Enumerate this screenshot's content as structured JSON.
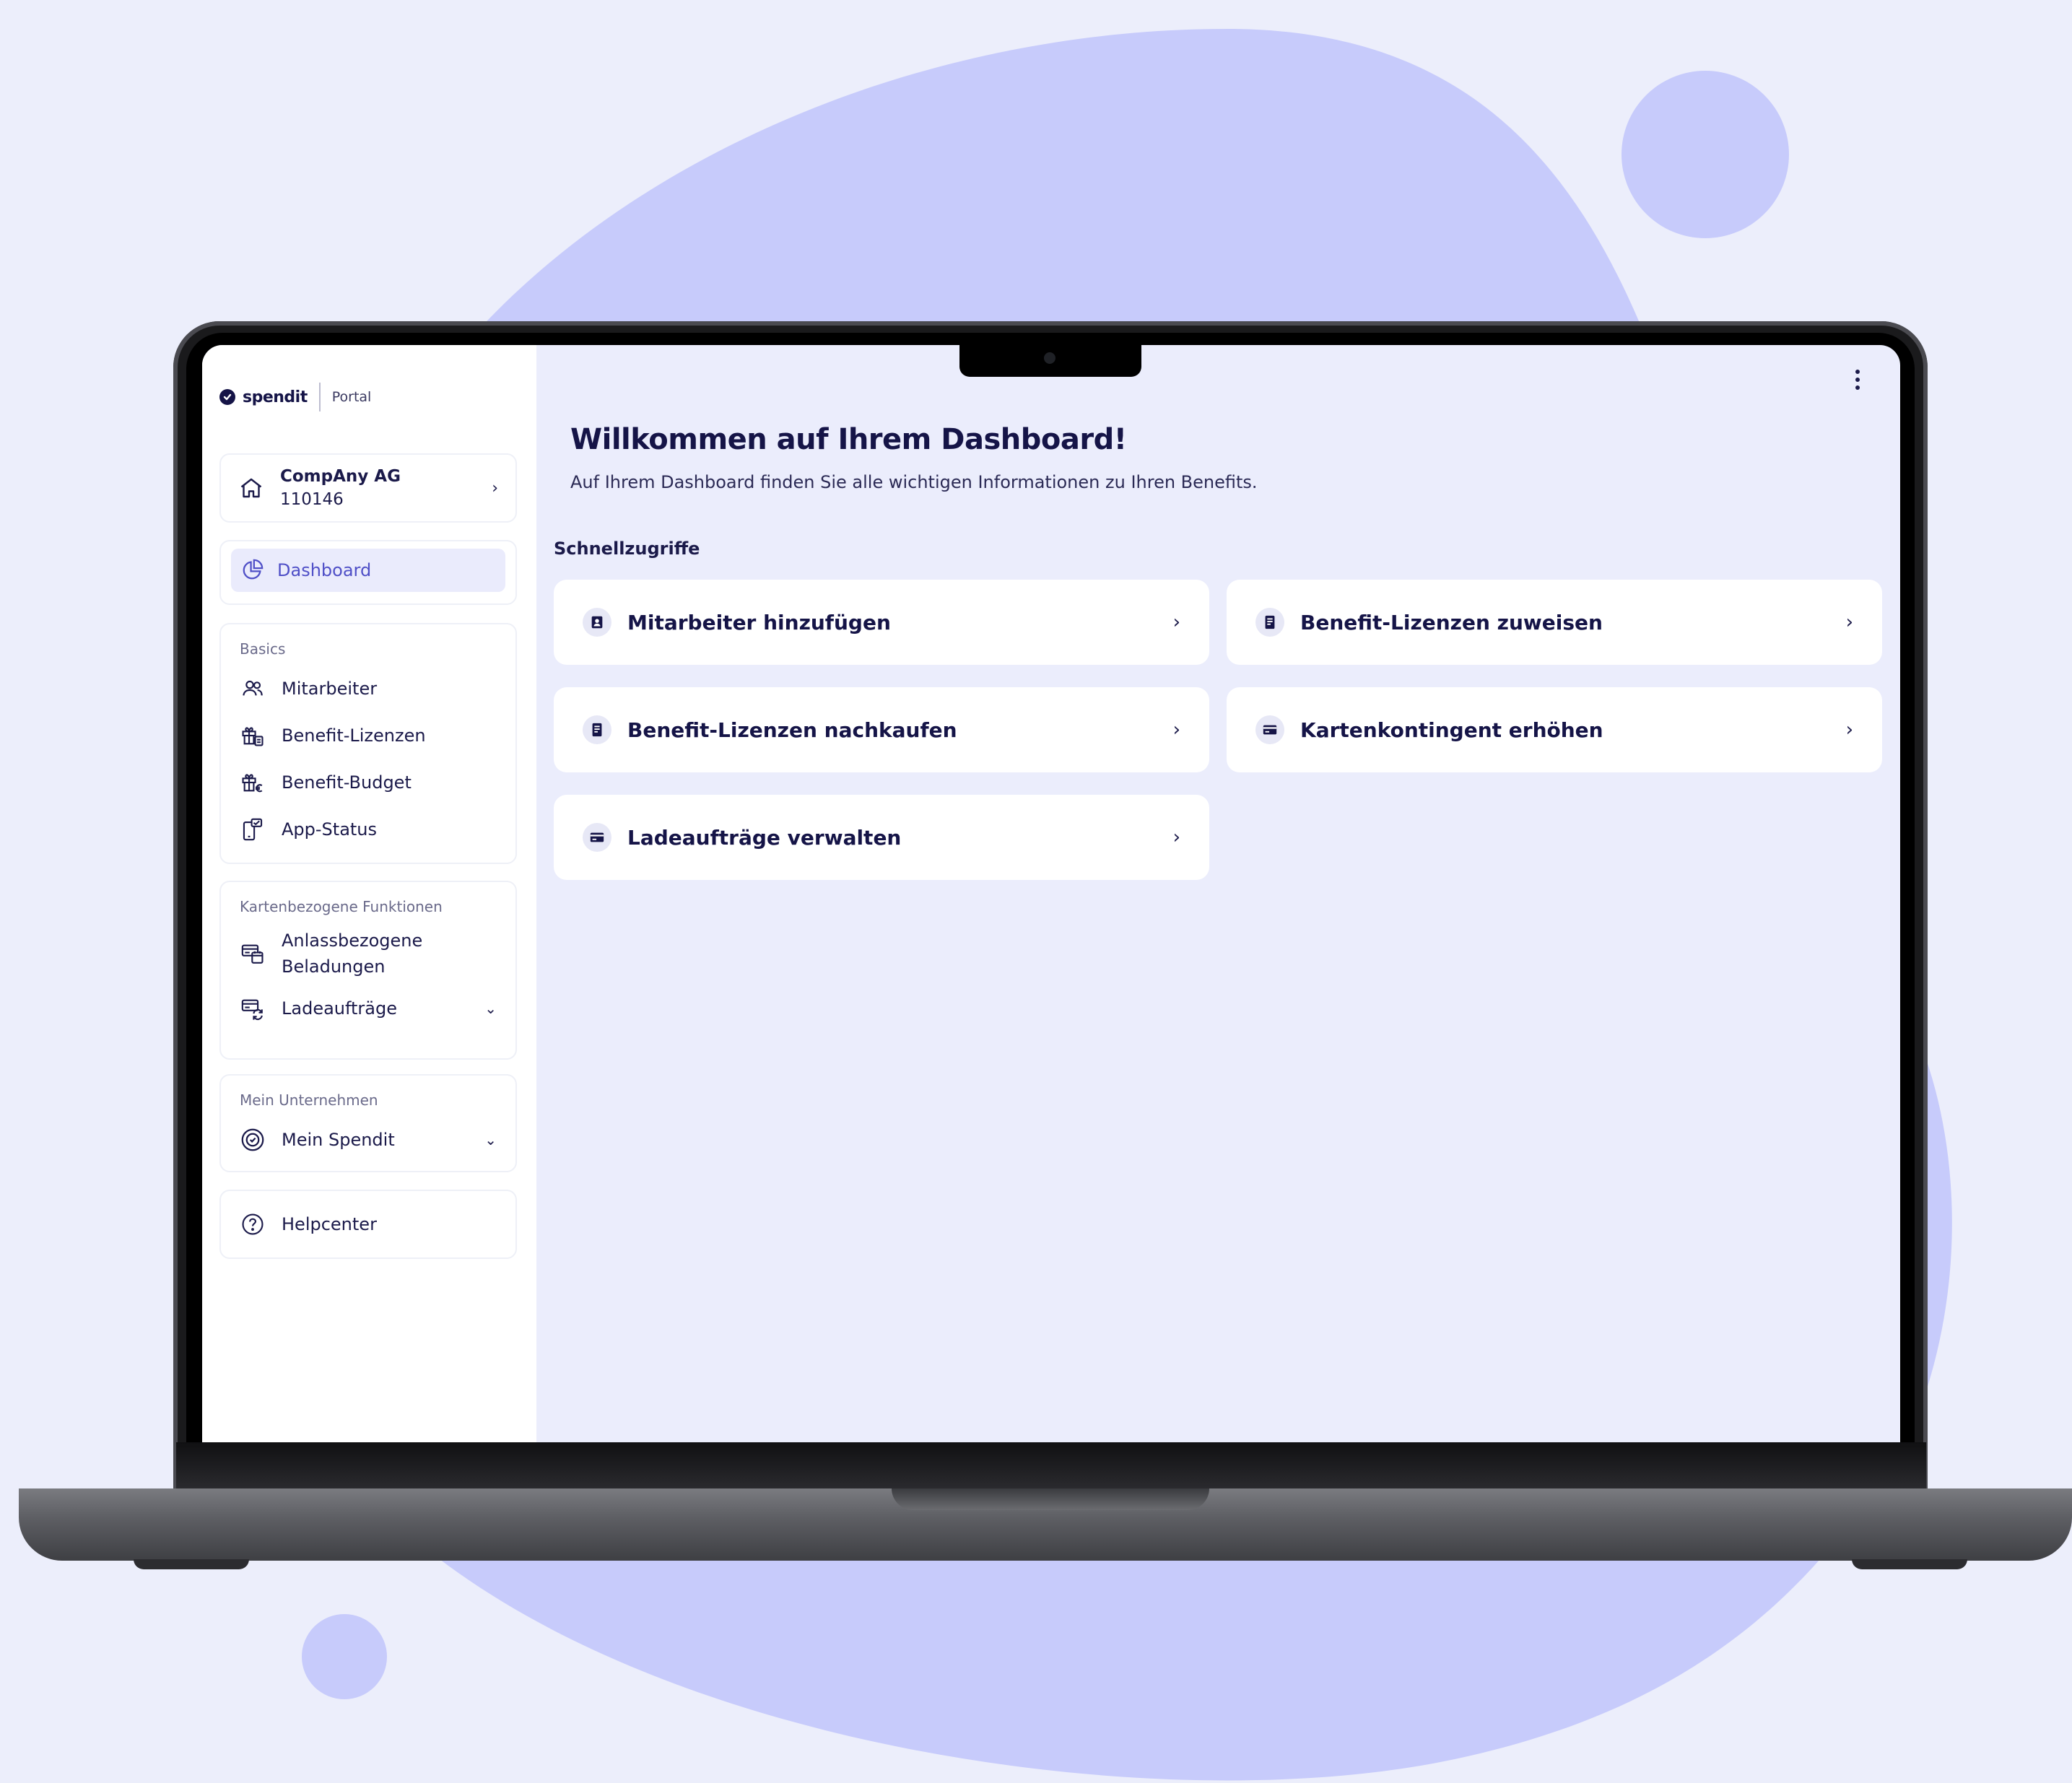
{
  "brand": {
    "logo_text": "spendit",
    "portal_label": "Portal"
  },
  "company": {
    "name": "CompAny AG",
    "number": "110146"
  },
  "sidebar": {
    "dashboard_label": "Dashboard",
    "basics": {
      "title": "Basics",
      "items": [
        {
          "label": "Mitarbeiter",
          "icon": "users-icon"
        },
        {
          "label": "Benefit-Lizenzen",
          "icon": "gift-license-icon"
        },
        {
          "label": "Benefit-Budget",
          "icon": "gift-euro-icon"
        },
        {
          "label": "App-Status",
          "icon": "phone-status-icon"
        }
      ]
    },
    "karten": {
      "title": "Kartenbezogene Funktionen",
      "items": [
        {
          "label_line1": "Anlassbezogene",
          "label_line2": "Beladungen",
          "icon": "card-calendar-icon"
        },
        {
          "label": "Ladeaufträge",
          "icon": "card-refresh-icon"
        }
      ]
    },
    "unternehmen": {
      "title": "Mein Unternehmen",
      "items": [
        {
          "label": "Mein Spendit",
          "icon": "spendit-badge-icon"
        }
      ]
    },
    "help_label": "Helpcenter"
  },
  "main": {
    "title": "Willkommen auf Ihrem Dashboard!",
    "subtitle": "Auf Ihrem Dashboard finden Sie alle wichtigen Informationen zu Ihren Benefits.",
    "quick_label": "Schnellzugriffe",
    "tiles": [
      {
        "label": "Mitarbeiter hinzufügen",
        "icon": "person-card-icon"
      },
      {
        "label": "Benefit-Lizenzen zuweisen",
        "icon": "license-doc-icon"
      },
      {
        "label": "Benefit-Lizenzen nachkaufen",
        "icon": "license-doc-icon"
      },
      {
        "label": "Kartenkontingent erhöhen",
        "icon": "credit-card-icon"
      },
      {
        "label": "Ladeaufträge verwalten",
        "icon": "credit-card-icon"
      }
    ]
  },
  "colors": {
    "background": "#eceefb",
    "blob": "#c7cbfb",
    "navy": "#151447",
    "accent": "#4f4fc7"
  }
}
